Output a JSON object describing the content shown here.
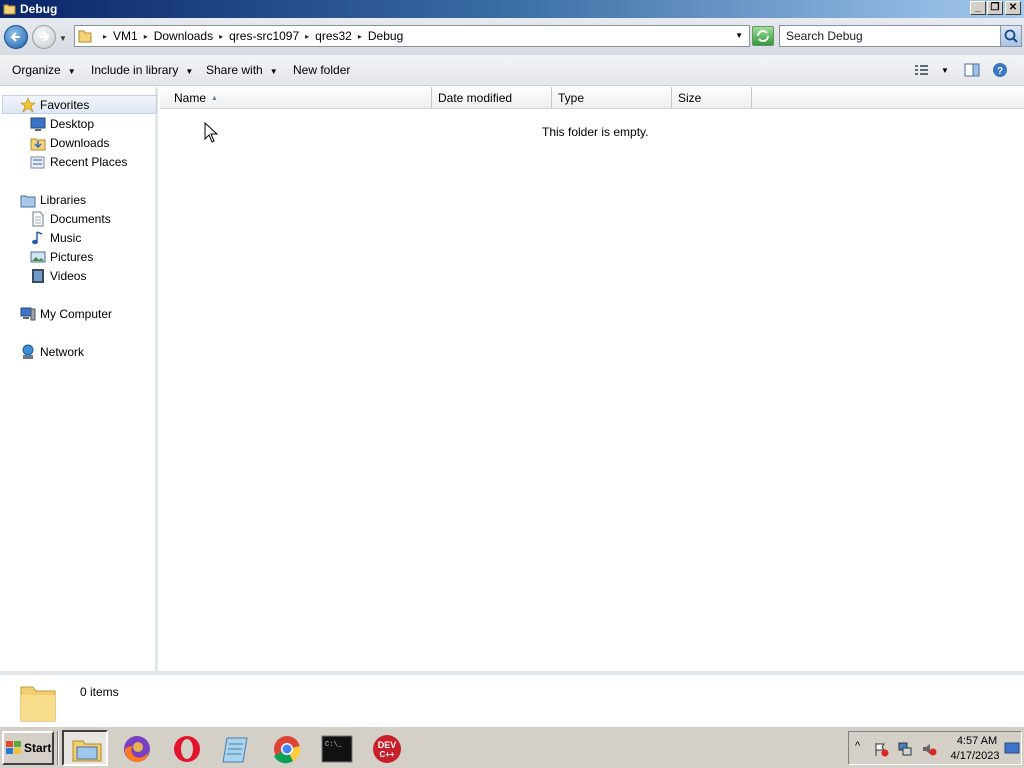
{
  "window": {
    "title": "Debug",
    "controls": {
      "minimize": "_",
      "maximize": "❐",
      "close": "✕"
    }
  },
  "address": {
    "breadcrumbs": [
      "VM1",
      "Downloads",
      "qres-src1097",
      "qres32",
      "Debug"
    ],
    "search_placeholder": "Search Debug"
  },
  "toolbar": {
    "organize": "Organize",
    "include_in_library": "Include in library",
    "share_with": "Share with",
    "new_folder": "New folder"
  },
  "nav_pane": {
    "favorites": {
      "label": "Favorites",
      "items": [
        "Desktop",
        "Downloads",
        "Recent Places"
      ]
    },
    "libraries": {
      "label": "Libraries",
      "items": [
        "Documents",
        "Music",
        "Pictures",
        "Videos"
      ]
    },
    "computer": "My Computer",
    "network": "Network"
  },
  "file_list": {
    "columns": [
      "Name",
      "Date modified",
      "Type",
      "Size"
    ],
    "sort_column": "Name",
    "empty_message": "This folder is empty."
  },
  "details": {
    "item_count": "0 items"
  },
  "taskbar": {
    "start_label": "Start",
    "apps": [
      "windows-explorer",
      "firefox",
      "opera",
      "notepad",
      "chrome",
      "command-prompt",
      "dev-cpp"
    ],
    "dev_icon_text": "DEV\nC++",
    "time": "4:57 AM",
    "date": "4/17/2023"
  },
  "colors": {
    "title_bar_start": "#0a246a",
    "title_bar_end": "#a6caf0",
    "selection": "#dde7f4",
    "taskbar": "#d4d0c8"
  }
}
